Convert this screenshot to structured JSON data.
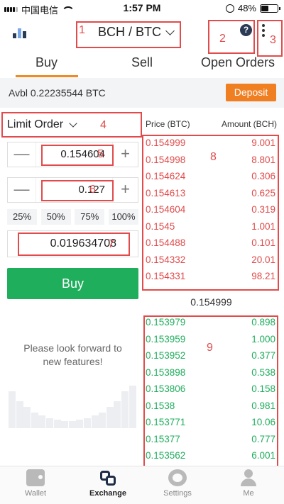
{
  "status_bar": {
    "carrier": "中国电信",
    "time": "1:57 PM",
    "battery": "48%",
    "battery_level": 0.48
  },
  "header": {
    "pair": "BCH / BTC",
    "help_glyph": "?",
    "icons": [
      "chart-icon",
      "chevron-down-icon",
      "help-icon",
      "more-icon"
    ]
  },
  "tabs": [
    {
      "label": "Buy",
      "active": true
    },
    {
      "label": "Sell",
      "active": false
    },
    {
      "label": "Open Orders",
      "active": false
    }
  ],
  "colors": {
    "accent_orange": "#f08a24",
    "buy_green": "#1fae5c",
    "ask_red": "#e04a4a",
    "annotation_red": "#e24b4b"
  },
  "account": {
    "avbl": "Avbl 0.22235544 BTC",
    "deposit_label": "Deposit"
  },
  "form": {
    "order_type": "Limit Order",
    "price_value": "0.154604",
    "amount_value": "0.127",
    "minus_glyph": "—",
    "plus_glyph": "+",
    "percentages": [
      "25%",
      "50%",
      "75%",
      "100%"
    ],
    "total_value": "0.019634708",
    "buy_label": "Buy"
  },
  "promo": {
    "line1": "Please look forward to",
    "line2": "new features!"
  },
  "order_book": {
    "price_header": "Price (BTC)",
    "amount_header": "Amount (BCH)",
    "asks": [
      {
        "price": "0.154999",
        "amount": "9.001"
      },
      {
        "price": "0.154998",
        "amount": "8.801"
      },
      {
        "price": "0.154624",
        "amount": "0.306"
      },
      {
        "price": "0.154613",
        "amount": "0.625"
      },
      {
        "price": "0.154604",
        "amount": "0.319"
      },
      {
        "price": "0.1545",
        "amount": "1.001"
      },
      {
        "price": "0.154488",
        "amount": "0.101"
      },
      {
        "price": "0.154332",
        "amount": "20.01"
      },
      {
        "price": "0.154331",
        "amount": "98.21"
      }
    ],
    "last_price": "0.154999",
    "bids": [
      {
        "price": "0.153979",
        "amount": "0.898"
      },
      {
        "price": "0.153959",
        "amount": "1.000"
      },
      {
        "price": "0.153952",
        "amount": "0.377"
      },
      {
        "price": "0.153898",
        "amount": "0.538"
      },
      {
        "price": "0.153806",
        "amount": "0.158"
      },
      {
        "price": "0.1538",
        "amount": "0.981"
      },
      {
        "price": "0.153771",
        "amount": "10.06"
      },
      {
        "price": "0.15377",
        "amount": "0.777"
      },
      {
        "price": "0.153562",
        "amount": "6.001"
      }
    ]
  },
  "annotations": [
    "1",
    "2",
    "3",
    "4",
    "5",
    "6",
    "7",
    "8",
    "9"
  ],
  "bottom_nav": [
    {
      "label": "Wallet",
      "icon": "wallet-icon"
    },
    {
      "label": "Exchange",
      "icon": "exchange-icon",
      "active": true
    },
    {
      "label": "Settings",
      "icon": "settings-icon"
    },
    {
      "label": "Me",
      "icon": "me-icon"
    }
  ]
}
